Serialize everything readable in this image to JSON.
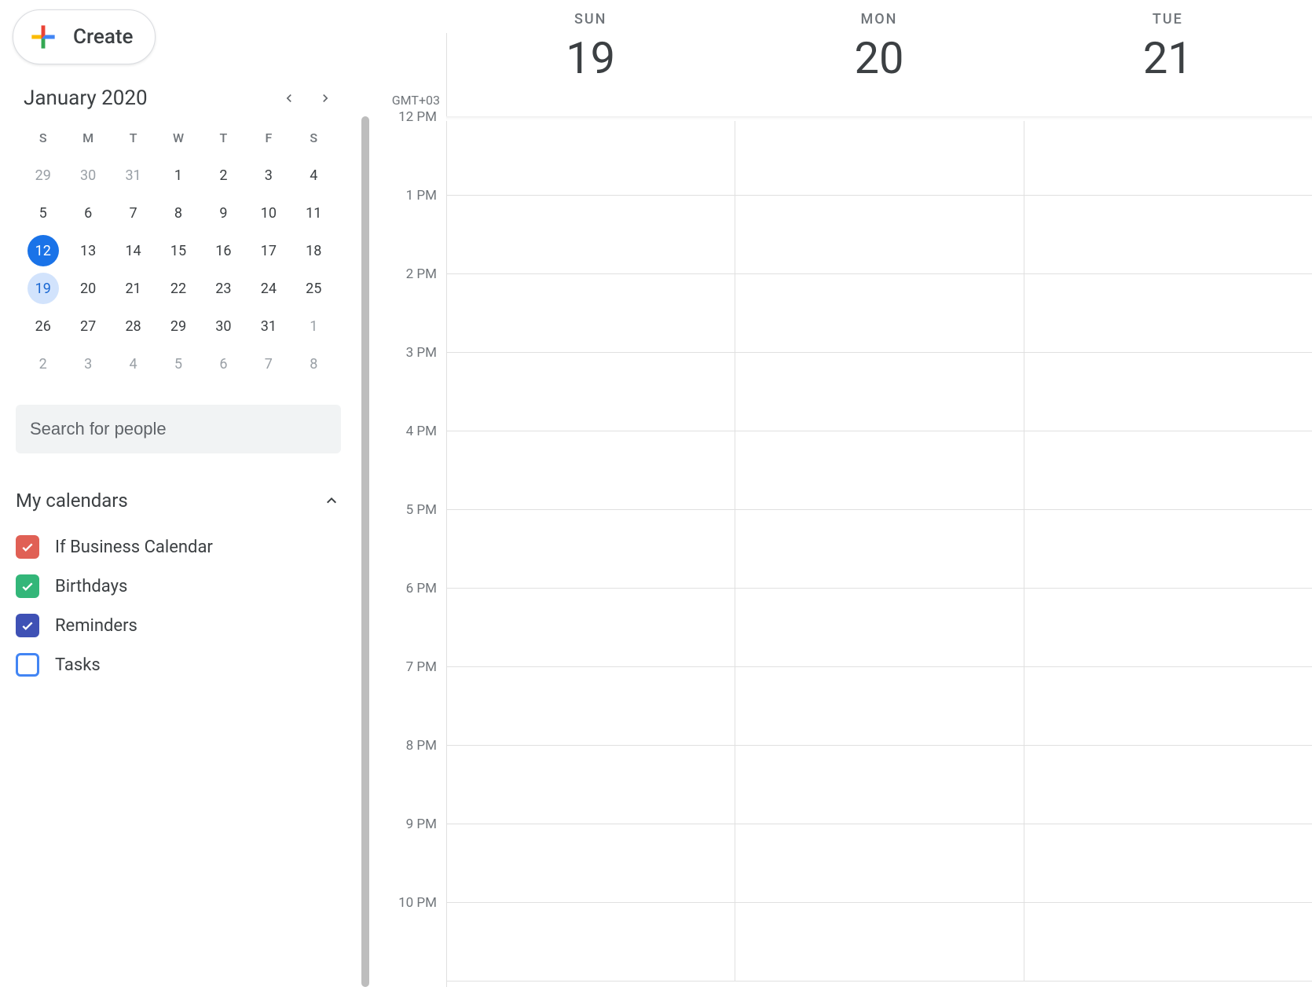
{
  "create": {
    "label": "Create"
  },
  "minical": {
    "title": "January 2020",
    "dow": [
      "S",
      "M",
      "T",
      "W",
      "T",
      "F",
      "S"
    ],
    "weeks": [
      [
        {
          "n": "29",
          "muted": true
        },
        {
          "n": "30",
          "muted": true
        },
        {
          "n": "31",
          "muted": true
        },
        {
          "n": "1"
        },
        {
          "n": "2"
        },
        {
          "n": "3"
        },
        {
          "n": "4"
        }
      ],
      [
        {
          "n": "5"
        },
        {
          "n": "6"
        },
        {
          "n": "7"
        },
        {
          "n": "8"
        },
        {
          "n": "9"
        },
        {
          "n": "10"
        },
        {
          "n": "11"
        }
      ],
      [
        {
          "n": "12",
          "today": true
        },
        {
          "n": "13"
        },
        {
          "n": "14"
        },
        {
          "n": "15"
        },
        {
          "n": "16"
        },
        {
          "n": "17"
        },
        {
          "n": "18"
        }
      ],
      [
        {
          "n": "19",
          "selected": true
        },
        {
          "n": "20"
        },
        {
          "n": "21"
        },
        {
          "n": "22"
        },
        {
          "n": "23"
        },
        {
          "n": "24"
        },
        {
          "n": "25"
        }
      ],
      [
        {
          "n": "26"
        },
        {
          "n": "27"
        },
        {
          "n": "28"
        },
        {
          "n": "29"
        },
        {
          "n": "30"
        },
        {
          "n": "31"
        },
        {
          "n": "1",
          "muted": true
        }
      ],
      [
        {
          "n": "2",
          "muted": true
        },
        {
          "n": "3",
          "muted": true
        },
        {
          "n": "4",
          "muted": true
        },
        {
          "n": "5",
          "muted": true
        },
        {
          "n": "6",
          "muted": true
        },
        {
          "n": "7",
          "muted": true
        },
        {
          "n": "8",
          "muted": true
        }
      ]
    ]
  },
  "search": {
    "placeholder": "Search for people"
  },
  "mycalendars": {
    "title": "My calendars",
    "items": [
      {
        "label": "If Business Calendar",
        "color": "#e06055",
        "checked": true
      },
      {
        "label": "Birthdays",
        "color": "#33b679",
        "checked": true
      },
      {
        "label": "Reminders",
        "color": "#3f51b5",
        "checked": true
      },
      {
        "label": "Tasks",
        "color": "#4285f4",
        "checked": false
      }
    ]
  },
  "timezone": "GMT+03",
  "days": [
    {
      "dow": "SUN",
      "num": "19"
    },
    {
      "dow": "MON",
      "num": "20"
    },
    {
      "dow": "TUE",
      "num": "21"
    }
  ],
  "hours": [
    "12 PM",
    "1 PM",
    "2 PM",
    "3 PM",
    "4 PM",
    "5 PM",
    "6 PM",
    "7 PM",
    "8 PM",
    "9 PM",
    "10 PM"
  ]
}
